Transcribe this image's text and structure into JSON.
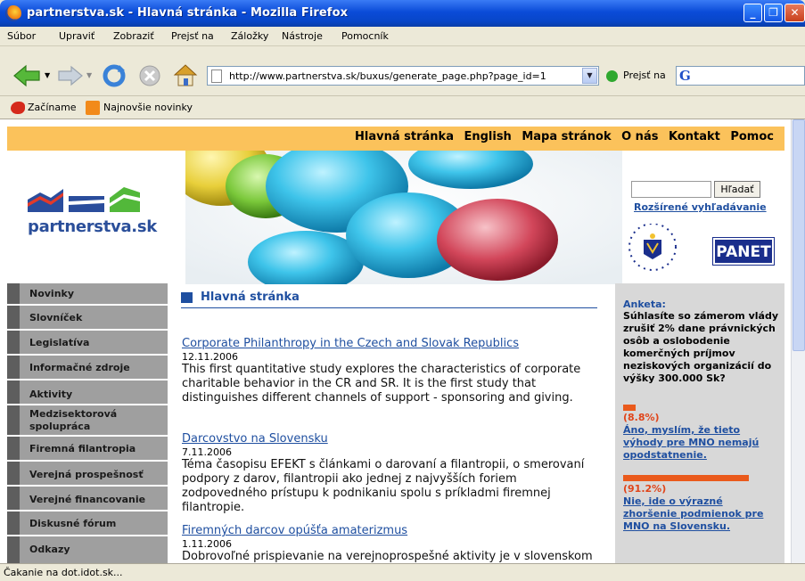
{
  "window": {
    "title": "partnerstva.sk - Hlavná stránka - Mozilla Firefox"
  },
  "menu": [
    "Súbor",
    "Upraviť",
    "Zobraziť",
    "Prejsť na",
    "Záložky",
    "Nástroje",
    "Pomocník"
  ],
  "toolbar": {
    "url": "http://www.partnerstva.sk/buxus/generate_page.php?page_id=1",
    "go_label": "Prejsť na",
    "search_engine": "G"
  },
  "bookmarks": [
    "Začíname",
    "Najnovšie novinky"
  ],
  "site": {
    "top_nav": [
      "Hlavná stránka",
      "English",
      "Mapa stránok",
      "O nás",
      "Kontakt",
      "Pomoc"
    ],
    "logo_text": "partnerstva.sk",
    "search_button": "Hľadať",
    "advanced_search": "Rozšírené vyhľadávanie",
    "partner_logo": "PANET",
    "left_nav": [
      {
        "label": "Novinky"
      },
      {
        "label": "Slovníček"
      },
      {
        "label": "Legislatíva"
      },
      {
        "label": "Informačné zdroje"
      },
      {
        "label": "Aktivity"
      },
      {
        "label": "Medzisektorová spolupráca"
      },
      {
        "label": "Firemná filantropia"
      },
      {
        "label": "Verejná prospešnosť"
      },
      {
        "label": "Verejné financovanie"
      },
      {
        "label": "Diskusné fórum"
      },
      {
        "label": "Odkazy"
      }
    ],
    "main_title": "Hlavná stránka",
    "articles": [
      {
        "title": "Corporate Philanthropy in the Czech and Slovak Republics",
        "date": "12.11.2006",
        "text": "This first quantitative study explores the characteristics of corporate charitable behavior in the CR and SR. It is the first study that distinguishes different channels of support - sponsoring and giving."
      },
      {
        "title": "Darcovstvo na Slovensku",
        "date": "7.11.2006",
        "text": "Téma časopisu EFEKT s článkami o darovaní a filantropii, o smerovaní podpory z darov, filantropii ako jednej z najvyšších foriem zodpovedného prístupu k podnikaniu spolu s príkladmi firemnej filantropie."
      },
      {
        "title": "Firemných darcov opúšťa amaterizmus",
        "date": "1.11.2006",
        "text": "Dobrovoľné prispievanie na verejnoprospešné aktivity je v slovenskom podnikaní"
      }
    ],
    "poll": {
      "heading": "Anketa:",
      "question": "Súhlasíte so zámerom vlády zrušiť 2% dane právnických osôb a oslobodenie komerčných príjmov neziskových organizácií do výšky 300.000 Sk?",
      "answers": [
        {
          "percent_label": "(8.8%)",
          "value": 8.8,
          "text": "Áno, myslím, že tieto výhody pre MNO nemajú opodstatnenie."
        },
        {
          "percent_label": "(91.2%)",
          "value": 91.2,
          "text": "Nie, ide o výrazné zhoršenie podmienok pre MNO na Slovensku."
        }
      ]
    }
  },
  "status": "Čakanie na dot.idot.sk..."
}
